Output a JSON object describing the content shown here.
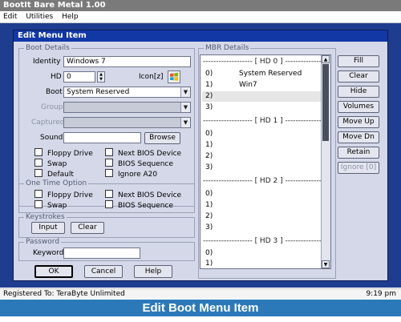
{
  "app": {
    "title": "BootIt Bare Metal 1.00",
    "menu": [
      "Edit",
      "Utilities",
      "Help"
    ]
  },
  "dialog": {
    "title": "Edit Menu Item",
    "boot_details": {
      "legend": "Boot Details",
      "identity_label": "Identity",
      "identity_value": "Windows 7",
      "hd_label": "HD",
      "hd_value": "0",
      "icon_label": "Icon[z]",
      "boot_label": "Boot",
      "boot_value": "System Reserved",
      "group_label": "Group",
      "group_value": "",
      "captured_label": "Captured",
      "captured_value": "",
      "sound_label": "Sound",
      "sound_value": "",
      "browse_label": "Browse",
      "checkboxes": [
        {
          "label": "Floppy Drive",
          "checked": false
        },
        {
          "label": "Next BIOS Device",
          "checked": false
        },
        {
          "label": "Swap",
          "checked": false
        },
        {
          "label": "BIOS Sequence",
          "checked": false
        },
        {
          "label": "Default",
          "checked": false
        },
        {
          "label": "Ignore A20",
          "checked": false
        }
      ]
    },
    "one_time": {
      "legend": "One Time Option",
      "checkboxes": [
        {
          "label": "Floppy Drive",
          "checked": false
        },
        {
          "label": "Next BIOS Device",
          "checked": false
        },
        {
          "label": "Swap",
          "checked": false
        },
        {
          "label": "BIOS Sequence",
          "checked": false
        }
      ]
    },
    "keystrokes": {
      "legend": "Keystrokes",
      "input_label": "Input",
      "clear_label": "Clear"
    },
    "password": {
      "legend": "Password",
      "keyword_label": "Keyword",
      "keyword_value": ""
    },
    "footer": {
      "ok": "OK",
      "cancel": "Cancel",
      "help": "Help"
    },
    "mbr": {
      "legend": "MBR Details",
      "sections": [
        {
          "header": "------------------- [ HD 0 ] -------------------",
          "rows": [
            {
              "num": "0)",
              "text": "System Reserved"
            },
            {
              "num": "1)",
              "text": "Win7"
            },
            {
              "num": "2)",
              "text": ""
            },
            {
              "num": "3)",
              "text": ""
            }
          ]
        },
        {
          "header": "------------------- [ HD 1 ] -------------------",
          "rows": [
            {
              "num": "0)",
              "text": ""
            },
            {
              "num": "1)",
              "text": ""
            },
            {
              "num": "2)",
              "text": ""
            },
            {
              "num": "3)",
              "text": ""
            }
          ]
        },
        {
          "header": "------------------- [ HD 2 ] -------------------",
          "rows": [
            {
              "num": "0)",
              "text": ""
            },
            {
              "num": "1)",
              "text": ""
            },
            {
              "num": "2)",
              "text": ""
            },
            {
              "num": "3)",
              "text": ""
            }
          ]
        },
        {
          "header": "------------------- [ HD 3 ] -------------------",
          "rows": [
            {
              "num": "0)",
              "text": ""
            },
            {
              "num": "1)",
              "text": ""
            }
          ]
        }
      ],
      "selected": "HD 0 / 2)"
    },
    "side_buttons": [
      "Fill",
      "Clear",
      "Hide",
      "Volumes",
      "Move Up",
      "Move Dn",
      "Retain",
      "Ignore [0]"
    ]
  },
  "status": {
    "left": "Registered To: TeraByte Unlimited",
    "right": "9:19 pm"
  },
  "caption": "Edit Boot Menu Item",
  "colors": {
    "desktop": "#1f3d8f",
    "dialog_title": "#1238a6",
    "caption_bar": "#2c79b9"
  },
  "icons": {
    "icon_button": "windows-logo-icon"
  }
}
